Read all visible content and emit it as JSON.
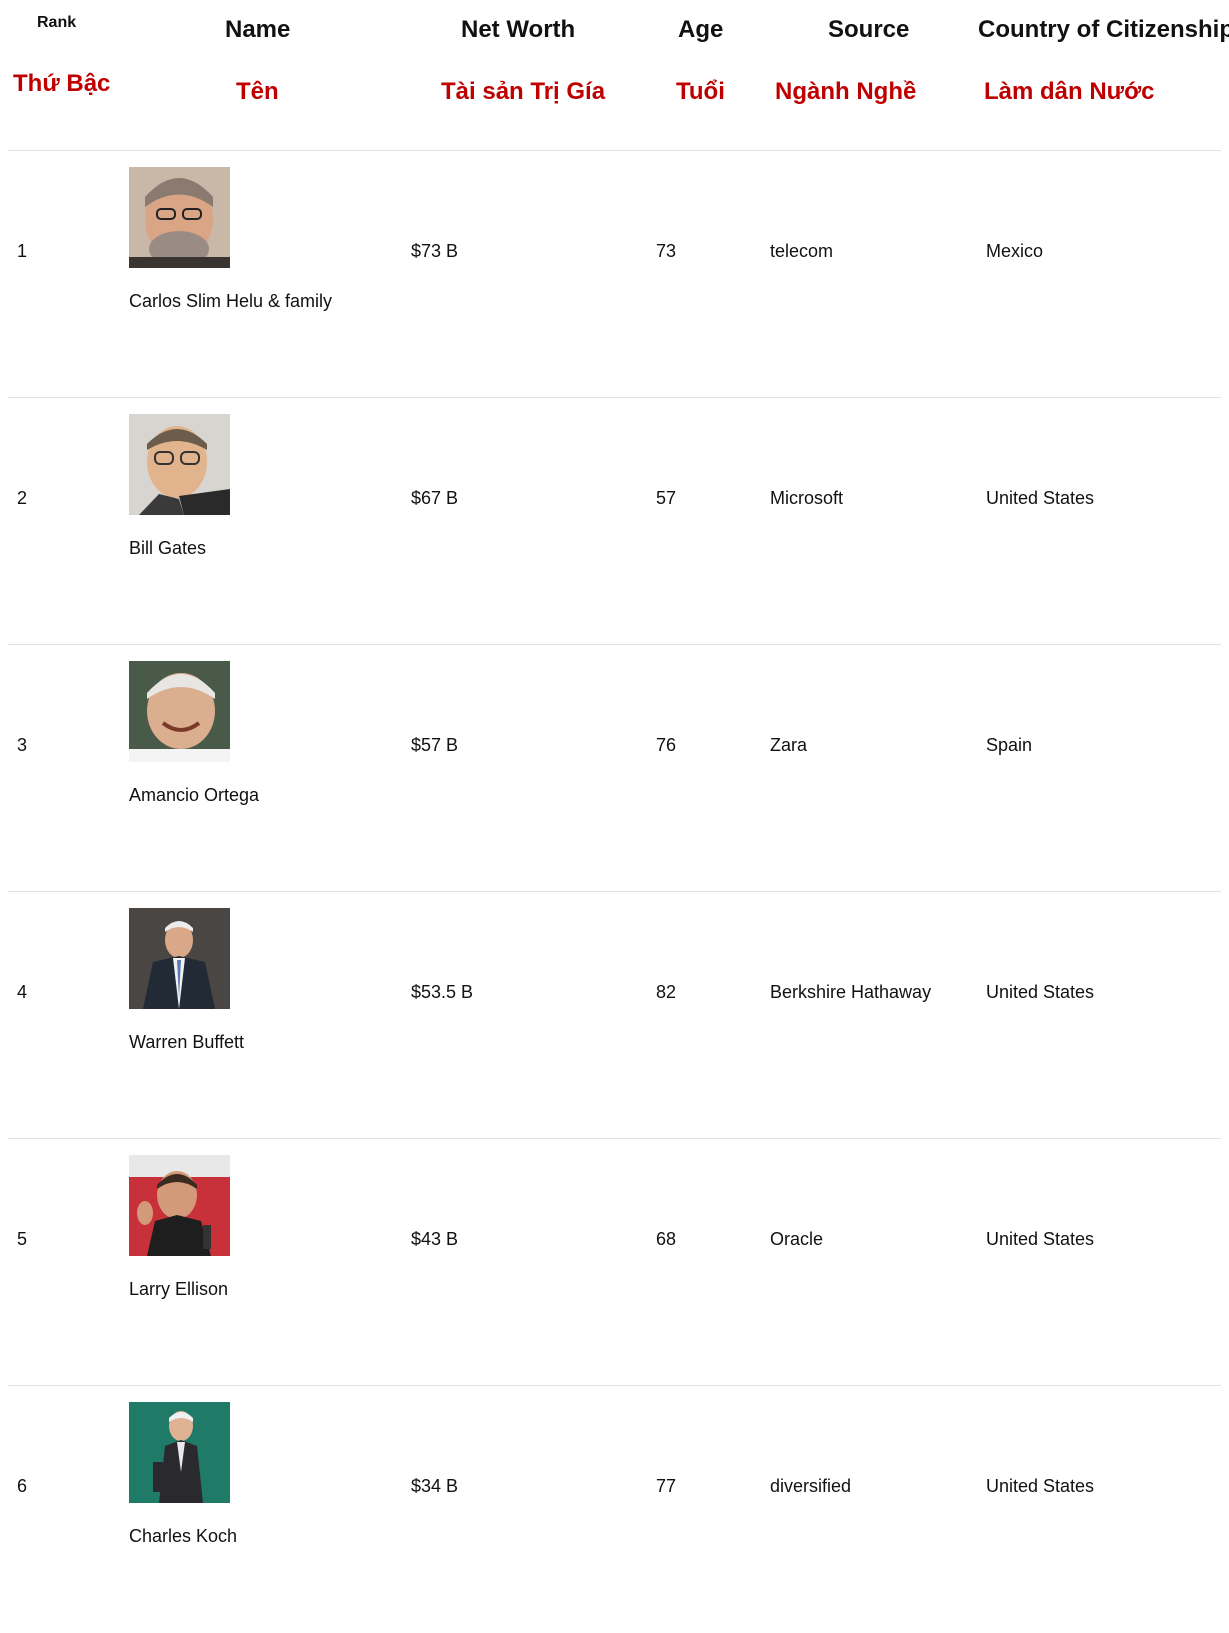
{
  "headers": {
    "rank": {
      "en": "Rank",
      "vi": "Thứ Bậc"
    },
    "name": {
      "en": "Name",
      "vi": "Tên"
    },
    "net_worth": {
      "en": "Net Worth",
      "vi": "Tài sản Trị Gía"
    },
    "age": {
      "en": "Age",
      "vi": "Tuổi"
    },
    "source": {
      "en": "Source",
      "vi": "Ngành Nghề"
    },
    "country": {
      "en": "Country of Citizenship",
      "vi": "Làm dân Nước"
    }
  },
  "rows": [
    {
      "rank": "1",
      "name": "Carlos Slim Helu & family",
      "net_worth": "$73 B",
      "age": "73",
      "source": "telecom",
      "country": "Mexico",
      "photo_icon": "person-photo-icon"
    },
    {
      "rank": "2",
      "name": "Bill Gates",
      "net_worth": "$67 B",
      "age": "57",
      "source": "Microsoft",
      "country": "United States",
      "photo_icon": "person-photo-icon"
    },
    {
      "rank": "3",
      "name": "Amancio Ortega",
      "net_worth": "$57 B",
      "age": "76",
      "source": "Zara",
      "country": "Spain",
      "photo_icon": "person-photo-icon"
    },
    {
      "rank": "4",
      "name": "Warren Buffett",
      "net_worth": "$53.5 B",
      "age": "82",
      "source": "Berkshire Hathaway",
      "country": "United States",
      "photo_icon": "person-photo-icon"
    },
    {
      "rank": "5",
      "name": "Larry Ellison",
      "net_worth": "$43 B",
      "age": "68",
      "source": "Oracle",
      "country": "United States",
      "photo_icon": "person-photo-icon"
    },
    {
      "rank": "6",
      "name": "Charles Koch",
      "net_worth": "$34 B",
      "age": "77",
      "source": "diversified",
      "country": "United States",
      "photo_icon": "person-photo-icon"
    }
  ],
  "colors": {
    "vietnamese_header": "#c00000",
    "divider": "#e1e1e1"
  }
}
